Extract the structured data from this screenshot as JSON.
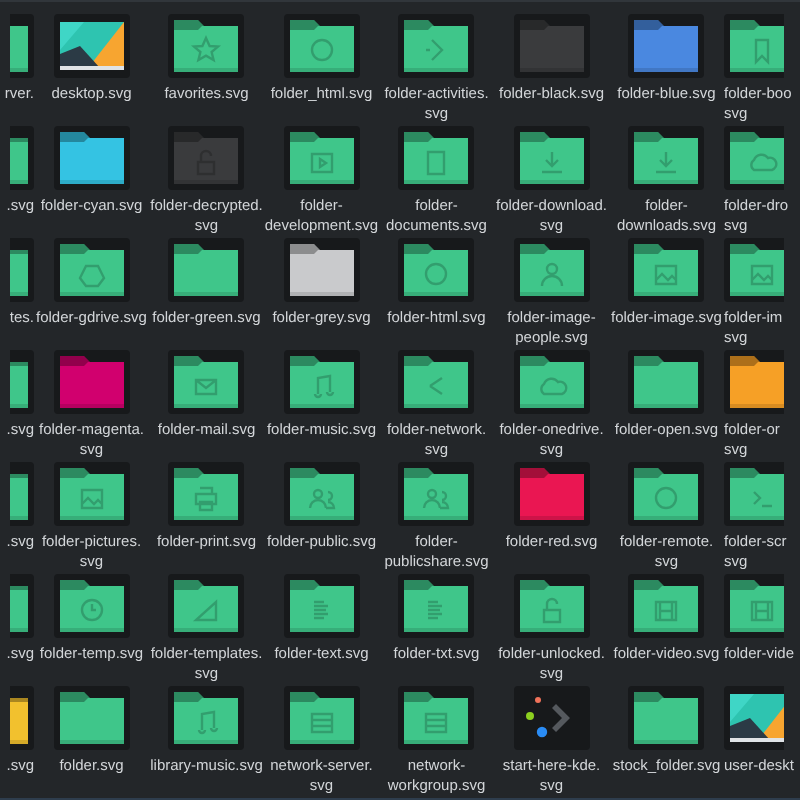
{
  "files": [
    {
      "lines": [
        "rver."
      ],
      "kind": "folder",
      "color": "#3fc68a"
    },
    {
      "lines": [
        "desktop.svg"
      ],
      "kind": "desktop"
    },
    {
      "lines": [
        "favorites.svg"
      ],
      "kind": "folder",
      "color": "#3fc68a"
    },
    {
      "lines": [
        "folder_html.svg"
      ],
      "kind": "folder",
      "color": "#3fc68a"
    },
    {
      "lines": [
        "folder-activities.",
        "svg"
      ],
      "kind": "folder",
      "color": "#3fc68a"
    },
    {
      "lines": [
        "folder-black.svg"
      ],
      "kind": "folder",
      "color": "#3a3b3d"
    },
    {
      "lines": [
        "folder-blue.svg"
      ],
      "kind": "folder",
      "color": "#4a88e0"
    },
    {
      "lines": [
        "folder-boo",
        "svg"
      ],
      "kind": "folder",
      "color": "#3fc68a"
    },
    {
      "lines": [
        ".svg"
      ],
      "kind": "folder",
      "color": "#3fc68a"
    },
    {
      "lines": [
        "folder-cyan.svg"
      ],
      "kind": "folder",
      "color": "#34c3e3"
    },
    {
      "lines": [
        "folder-decrypted.",
        "svg"
      ],
      "kind": "folder",
      "color": "#3a3b3d"
    },
    {
      "lines": [
        "folder-",
        "development.svg"
      ],
      "kind": "folder",
      "color": "#3fc68a"
    },
    {
      "lines": [
        "folder-",
        "documents.svg"
      ],
      "kind": "folder",
      "color": "#3fc68a"
    },
    {
      "lines": [
        "folder-download.",
        "svg"
      ],
      "kind": "folder",
      "color": "#3fc68a"
    },
    {
      "lines": [
        "folder-",
        "downloads.svg"
      ],
      "kind": "folder",
      "color": "#3fc68a"
    },
    {
      "lines": [
        "folder-dro",
        "svg"
      ],
      "kind": "folder",
      "color": "#3fc68a"
    },
    {
      "lines": [
        "tes."
      ],
      "kind": "folder",
      "color": "#3fc68a"
    },
    {
      "lines": [
        "folder-gdrive.svg"
      ],
      "kind": "folder",
      "color": "#3fc68a"
    },
    {
      "lines": [
        "folder-green.svg"
      ],
      "kind": "folder",
      "color": "#3fc68a"
    },
    {
      "lines": [
        "folder-grey.svg"
      ],
      "kind": "folder",
      "color": "#c9cacc"
    },
    {
      "lines": [
        "folder-html.svg"
      ],
      "kind": "folder",
      "color": "#3fc68a"
    },
    {
      "lines": [
        "folder-image-",
        "people.svg"
      ],
      "kind": "folder",
      "color": "#3fc68a"
    },
    {
      "lines": [
        "folder-image.svg"
      ],
      "kind": "folder",
      "color": "#3fc68a"
    },
    {
      "lines": [
        "folder-im",
        "svg"
      ],
      "kind": "folder",
      "color": "#3fc68a"
    },
    {
      "lines": [
        ".svg"
      ],
      "kind": "folder",
      "color": "#3fc68a"
    },
    {
      "lines": [
        "folder-magenta.",
        "svg"
      ],
      "kind": "folder",
      "color": "#d1006e"
    },
    {
      "lines": [
        "folder-mail.svg"
      ],
      "kind": "folder",
      "color": "#3fc68a"
    },
    {
      "lines": [
        "folder-music.svg"
      ],
      "kind": "folder",
      "color": "#3fc68a"
    },
    {
      "lines": [
        "folder-network.",
        "svg"
      ],
      "kind": "folder",
      "color": "#3fc68a"
    },
    {
      "lines": [
        "folder-onedrive.",
        "svg"
      ],
      "kind": "folder",
      "color": "#3fc68a"
    },
    {
      "lines": [
        "folder-open.svg"
      ],
      "kind": "folder",
      "color": "#3fc68a"
    },
    {
      "lines": [
        "folder-or",
        "svg"
      ],
      "kind": "folder",
      "color": "#f6a026"
    },
    {
      "lines": [
        ".svg"
      ],
      "kind": "folder",
      "color": "#3fc68a"
    },
    {
      "lines": [
        "folder-pictures.",
        "svg"
      ],
      "kind": "folder",
      "color": "#3fc68a"
    },
    {
      "lines": [
        "folder-print.svg"
      ],
      "kind": "folder",
      "color": "#3fc68a"
    },
    {
      "lines": [
        "folder-public.svg"
      ],
      "kind": "folder",
      "color": "#3fc68a"
    },
    {
      "lines": [
        "folder-",
        "publicshare.svg"
      ],
      "kind": "folder",
      "color": "#3fc68a"
    },
    {
      "lines": [
        "folder-red.svg"
      ],
      "kind": "folder",
      "color": "#ea1652"
    },
    {
      "lines": [
        "folder-remote.",
        "svg"
      ],
      "kind": "folder",
      "color": "#3fc68a"
    },
    {
      "lines": [
        "folder-scr",
        "svg"
      ],
      "kind": "folder",
      "color": "#3fc68a"
    },
    {
      "lines": [
        ".svg"
      ],
      "kind": "folder",
      "color": "#3fc68a"
    },
    {
      "lines": [
        "folder-temp.svg"
      ],
      "kind": "folder",
      "color": "#3fc68a"
    },
    {
      "lines": [
        "folder-templates.",
        "svg"
      ],
      "kind": "folder",
      "color": "#3fc68a"
    },
    {
      "lines": [
        "folder-text.svg"
      ],
      "kind": "folder",
      "color": "#3fc68a"
    },
    {
      "lines": [
        "folder-txt.svg"
      ],
      "kind": "folder",
      "color": "#3fc68a"
    },
    {
      "lines": [
        "folder-unlocked.",
        "svg"
      ],
      "kind": "folder",
      "color": "#3fc68a"
    },
    {
      "lines": [
        "folder-video.svg"
      ],
      "kind": "folder",
      "color": "#3fc68a"
    },
    {
      "lines": [
        "folder-vide"
      ],
      "kind": "folder",
      "color": "#3fc68a"
    },
    {
      "lines": [
        ".svg"
      ],
      "kind": "folder",
      "color": "#f2c12e"
    },
    {
      "lines": [
        "folder.svg"
      ],
      "kind": "folder",
      "color": "#3fc68a"
    },
    {
      "lines": [
        "library-music.svg"
      ],
      "kind": "folder",
      "color": "#3fc68a"
    },
    {
      "lines": [
        "network-server.",
        "svg"
      ],
      "kind": "folder",
      "color": "#3fc68a"
    },
    {
      "lines": [
        "network-",
        "workgroup.svg"
      ],
      "kind": "folder",
      "color": "#3fc68a"
    },
    {
      "lines": [
        "start-here-kde.",
        "svg"
      ],
      "kind": "start-here"
    },
    {
      "lines": [
        "stock_folder.svg"
      ],
      "kind": "folder",
      "color": "#3fc68a"
    },
    {
      "lines": [
        "user-deskt"
      ],
      "kind": "desktop"
    }
  ]
}
